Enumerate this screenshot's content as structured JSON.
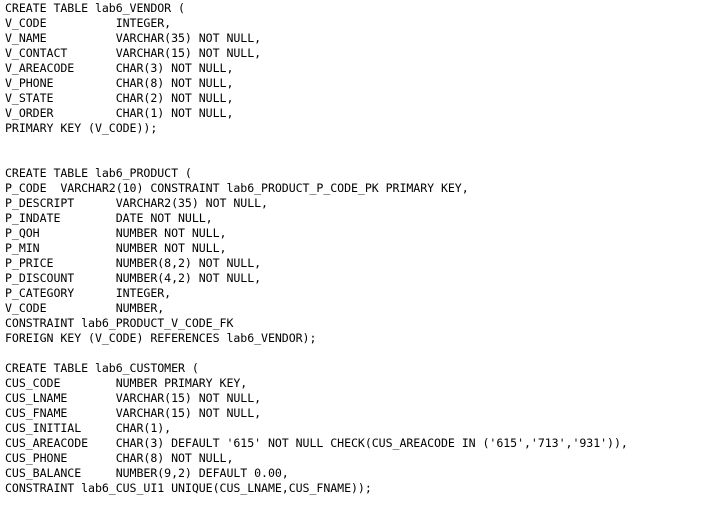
{
  "document": {
    "type": "sql-ddl-script",
    "language": "SQL",
    "background_color": "#ffffff",
    "text_color": "#000000",
    "statement_count": 3,
    "tables": [
      "lab6_VENDOR",
      "lab6_PRODUCT",
      "lab6_CUSTOMER"
    ],
    "lines": [
      "CREATE TABLE lab6_VENDOR (",
      "V_CODE          INTEGER,",
      "V_NAME          VARCHAR(35) NOT NULL,",
      "V_CONTACT       VARCHAR(15) NOT NULL,",
      "V_AREACODE      CHAR(3) NOT NULL,",
      "V_PHONE         CHAR(8) NOT NULL,",
      "V_STATE         CHAR(2) NOT NULL,",
      "V_ORDER         CHAR(1) NOT NULL,",
      "PRIMARY KEY (V_CODE));",
      "",
      "",
      "CREATE TABLE lab6_PRODUCT (",
      "P_CODE  VARCHAR2(10) CONSTRAINT lab6_PRODUCT_P_CODE_PK PRIMARY KEY,",
      "P_DESCRIPT      VARCHAR2(35) NOT NULL,",
      "P_INDATE        DATE NOT NULL,",
      "P_QOH           NUMBER NOT NULL,",
      "P_MIN           NUMBER NOT NULL,",
      "P_PRICE         NUMBER(8,2) NOT NULL,",
      "P_DISCOUNT      NUMBER(4,2) NOT NULL,",
      "P_CATEGORY      INTEGER,",
      "V_CODE          NUMBER,",
      "CONSTRAINT lab6_PRODUCT_V_CODE_FK",
      "FOREIGN KEY (V_CODE) REFERENCES lab6_VENDOR);",
      "",
      "CREATE TABLE lab6_CUSTOMER (",
      "CUS_CODE        NUMBER PRIMARY KEY,",
      "CUS_LNAME       VARCHAR(15) NOT NULL,",
      "CUS_FNAME       VARCHAR(15) NOT NULL,",
      "CUS_INITIAL     CHAR(1),",
      "CUS_AREACODE    CHAR(3) DEFAULT '615' NOT NULL CHECK(CUS_AREACODE IN ('615','713','931')),",
      "CUS_PHONE       CHAR(8) NOT NULL,",
      "CUS_BALANCE     NUMBER(9,2) DEFAULT 0.00,",
      "CONSTRAINT lab6_CUS_UI1 UNIQUE(CUS_LNAME,CUS_FNAME));"
    ]
  }
}
